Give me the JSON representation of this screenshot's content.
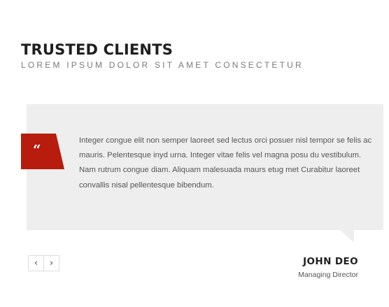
{
  "section": {
    "title": "TRUSTED CLIENTS",
    "subtitle": "LOREM IPSUM DOLOR SIT AMET CONSECTETUR"
  },
  "testimonial": {
    "quote_glyph": "“",
    "text": "Integer congue elit non semper laoreet sed lectus orci posuer nisl tempor se felis ac mauris. Pelentesque inyd urna. Integer vitae felis vel magna posu du vestibulum. Nam rutrum congue diam. Aliquam malesuada maurs etug met Curabitur laoreet convallis nisal pellentesque bibendum.",
    "author_name": "JOHN DEO",
    "author_role": "Managing Director"
  },
  "navigation": {
    "prev_label": "‹",
    "next_label": "›"
  },
  "colors": {
    "accent": "#b71c0c",
    "card_background": "#eeeeee"
  },
  "icons": {
    "quote": "quote-icon",
    "prev": "chevron-left-icon",
    "next": "chevron-right-icon"
  }
}
